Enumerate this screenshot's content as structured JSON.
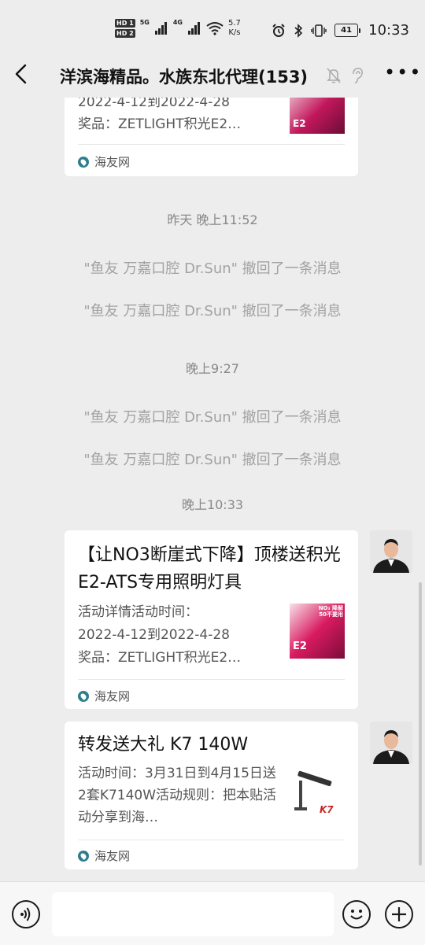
{
  "status_bar": {
    "hd1": "HD 1",
    "hd2": "HD 2",
    "net1": "5G",
    "net2": "4G",
    "speed_value": "5.7",
    "speed_unit": "K/s",
    "battery": "41",
    "time": "10:33"
  },
  "header": {
    "title": "洋滨海精品。水族东北代理(153)"
  },
  "messages": {
    "card_top": {
      "desc_line1": "2022-4-12到2022-4-28",
      "desc_line2": "奖品：ZETLIGHT积光E2…",
      "thumb_text": "E2",
      "source": "海友网"
    },
    "ts1": "昨天 晚上11:52",
    "recall1": "\"鱼友 万嘉口腔 Dr.Sun\" 撤回了一条消息",
    "recall2": "\"鱼友 万嘉口腔 Dr.Sun\" 撤回了一条消息",
    "ts2": "晚上9:27",
    "recall3": "\"鱼友 万嘉口腔 Dr.Sun\" 撤回了一条消息",
    "recall4": "\"鱼友 万嘉口腔 Dr.Sun\" 撤回了一条消息",
    "ts3": "晚上10:33",
    "card1": {
      "title": "【让NO3断崖式下降】顶楼送积光E2-ATS专用照明灯具",
      "desc_line1": "活动详情活动时间：",
      "desc_line2": "2022-4-12到2022-4-28",
      "desc_line3": "奖品：ZETLIGHT积光E2…",
      "thumb_text": "E2",
      "thumb_badge": "NO₃ 降解 50不要用",
      "source": "海友网"
    },
    "card2": {
      "title": "转发送大礼 K7 140W",
      "desc": "活动时间：3月31日到4月15日送2套K7140W活动规则：把本贴活动分享到海…",
      "thumb_text": "K7",
      "source": "海友网"
    }
  },
  "input_bar": {
    "placeholder": ""
  },
  "colors": {
    "background": "#ededed",
    "card": "#ffffff",
    "system_text": "#a2a2a2",
    "timestamp_text": "#888888",
    "thumb_pink": "#c2185b"
  },
  "icons": [
    "back-arrow-icon",
    "bell-mute-icon",
    "ear-icon",
    "more-icon",
    "voice-icon",
    "emoji-icon",
    "plus-icon",
    "wifi-icon",
    "alarm-icon",
    "bluetooth-icon",
    "vibrate-icon",
    "battery-icon"
  ]
}
